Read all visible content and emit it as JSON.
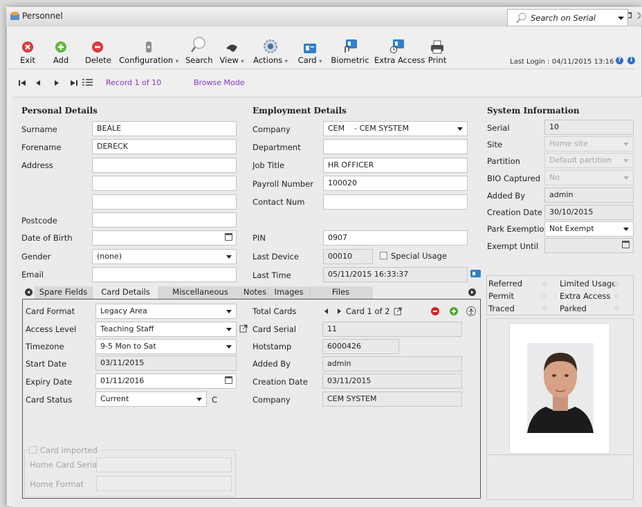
{
  "window": {
    "title": "Personnel"
  },
  "toolbar": {
    "buttons": [
      {
        "label": "Exit",
        "icon": "exit-icon"
      },
      {
        "label": "Add",
        "icon": "add-icon"
      },
      {
        "label": "Delete",
        "icon": "delete-icon"
      },
      {
        "label": "Configuration",
        "icon": "configuration-icon",
        "dropdown": true
      },
      {
        "label": "Search",
        "icon": "search-icon"
      },
      {
        "label": "View",
        "icon": "view-icon",
        "dropdown": true
      },
      {
        "label": "Actions",
        "icon": "actions-icon",
        "dropdown": true
      },
      {
        "label": "Card",
        "icon": "card-icon",
        "dropdown": true
      },
      {
        "label": "Biometric",
        "icon": "biometric-icon"
      },
      {
        "label": "Extra Access",
        "icon": "extra-access-icon"
      },
      {
        "label": "Print",
        "icon": "print-icon"
      }
    ],
    "search_placeholder": "Search on Serial",
    "last_login": "Last Login : 04/11/2015 13:16"
  },
  "navigator": {
    "record": "Record 1 of 10",
    "mode": "Browse Mode"
  },
  "personal": {
    "heading": "Personal Details",
    "surname_label": "Surname",
    "surname": "BEALE",
    "forename_label": "Forename",
    "forename": "DERECK",
    "address_label": "Address",
    "address1": "",
    "address2": "",
    "address3": "",
    "postcode_label": "Postcode",
    "postcode": "",
    "dob_label": "Date of Birth",
    "dob": "",
    "gender_label": "Gender",
    "gender": "(none)",
    "email_label": "Email",
    "email": ""
  },
  "employment": {
    "heading": "Employment Details",
    "company_label": "Company",
    "company": "CEM    - CEM SYSTEM",
    "department_label": "Department",
    "department": "",
    "job_title_label": "Job Title",
    "job_title": "HR OFFICER",
    "payroll_label": "Payroll Number",
    "payroll": "100020",
    "contact_label": "Contact Num",
    "contact": "",
    "pin_label": "PIN",
    "pin": "0907",
    "last_device_label": "Last Device",
    "last_device": "00010",
    "special_usage_label": "Special Usage",
    "last_time_label": "Last Time",
    "last_time": "05/11/2015 16:33:37"
  },
  "system": {
    "heading": "System Information",
    "serial_label": "Serial",
    "serial": "10",
    "site_label": "Site",
    "site": "Home site",
    "partition_label": "Partition",
    "partition": "Default partition",
    "bio_label": "BIO Captured",
    "bio": "No",
    "added_by_label": "Added By",
    "added_by": "admin",
    "creation_label": "Creation Date",
    "creation": "30/10/2015",
    "park_label": "Park Exemption",
    "park": "Not Exempt",
    "exempt_label": "Exempt Until",
    "exempt": "",
    "flags": [
      "Referred",
      "Limited Usage",
      "Permit",
      "Extra Access",
      "Traced",
      "Parked"
    ]
  },
  "tabs": [
    "Spare Fields",
    "Card Details",
    "Miscellaneous",
    "Notes",
    "Images",
    "Files"
  ],
  "card": {
    "format_label": "Card Format",
    "format": "Legacy Area",
    "access_label": "Access Level",
    "access": "Teaching Staff",
    "timezone_label": "Timezone",
    "timezone": "9-5 Mon to Sat",
    "start_label": "Start Date",
    "start": "03/11/2015",
    "expiry_label": "Expiry Date",
    "expiry": "01/11/2016",
    "status_label": "Card Status",
    "status": "Current",
    "status_code": "C",
    "total_cards_label": "Total Cards",
    "card_nav": "Card 1 of 2",
    "serial_label": "Card Serial",
    "serial": "11",
    "hotstamp_label": "Hotstamp",
    "hotstamp": "6000426",
    "added_by_label": "Added By",
    "added_by": "admin",
    "creation_label": "Creation Date",
    "creation": "03/11/2015",
    "company_label": "Company",
    "company": "CEM SYSTEM",
    "imported_label": "Card imported",
    "home_serial_label": "Home Card Serial",
    "home_serial": "",
    "home_format_label": "Home Format",
    "home_format": ""
  }
}
